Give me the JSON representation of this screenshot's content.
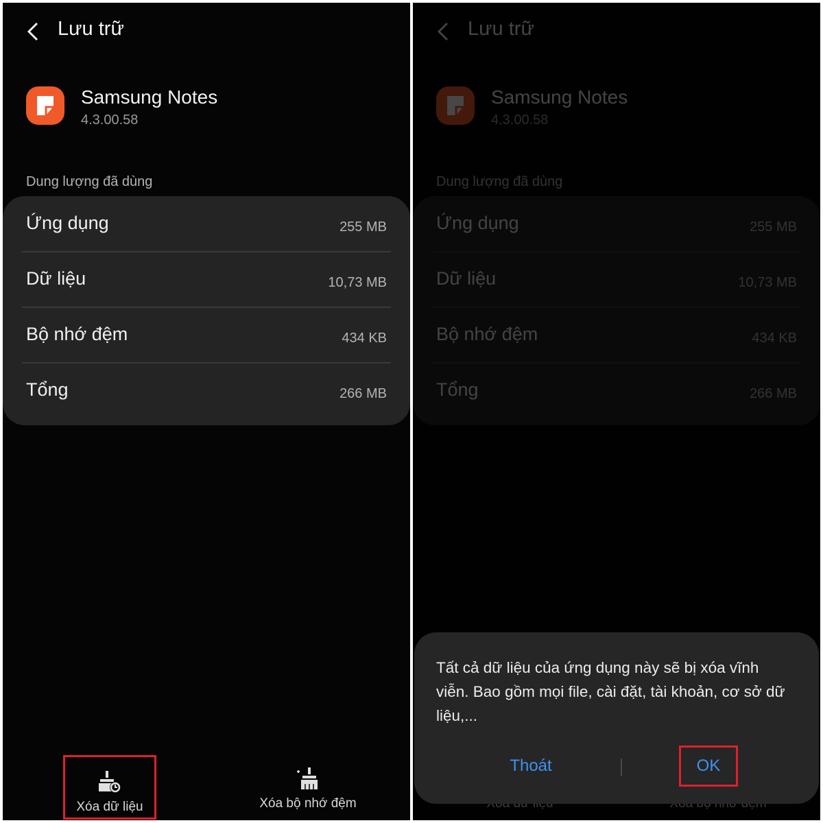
{
  "header": {
    "title": "Lưu trữ"
  },
  "app": {
    "name": "Samsung Notes",
    "version": "4.3.00.58"
  },
  "storage": {
    "section_label": "Dung lượng đã dùng",
    "rows": [
      {
        "label": "Ứng dụng",
        "value": "255 MB"
      },
      {
        "label": "Dữ liệu",
        "value": "10,73 MB"
      },
      {
        "label": "Bộ nhớ đệm",
        "value": "434 KB"
      },
      {
        "label": "Tổng",
        "value": "266 MB"
      }
    ]
  },
  "bottom_bar": {
    "clear_data_label": "Xóa dữ liệu",
    "clear_cache_label": "Xóa bộ nhớ đệm"
  },
  "dialog": {
    "message": "Tất cả dữ liệu của ứng dụng này sẽ bị xóa vĩnh viễn. Bao gồm mọi file, cài đặt, tài khoản, cơ sở dữ liệu,...",
    "cancel_label": "Thoát",
    "ok_label": "OK"
  },
  "colors": {
    "accent": "#3e91f0",
    "app_icon": "#f05a28",
    "highlight": "#e0202c"
  }
}
